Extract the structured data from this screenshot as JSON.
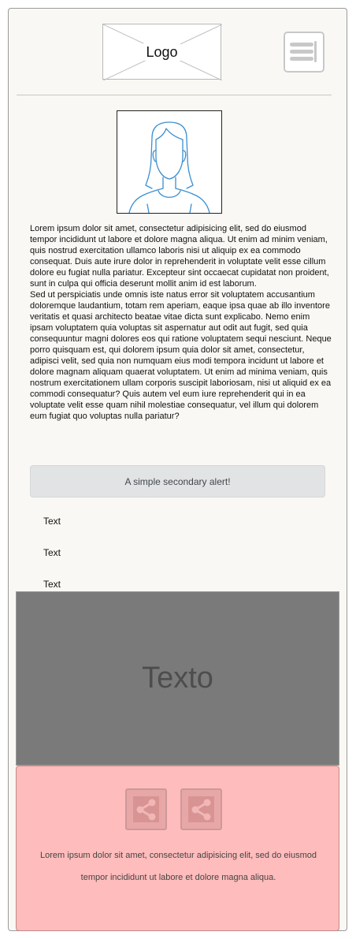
{
  "header": {
    "logo_label": "Logo",
    "menu_icon": "hamburger-menu-icon"
  },
  "profile": {
    "avatar_icon": "female-avatar-icon"
  },
  "content": {
    "paragraph_1": "Lorem ipsum dolor sit amet, consectetur adipisicing elit, sed do eiusmod tempor incididunt ut labore et dolore magna aliqua. Ut enim ad minim veniam, quis nostrud exercitation ullamco laboris nisi ut aliquip ex ea commodo consequat. Duis aute irure dolor in reprehenderit in voluptate velit esse cillum dolore eu fugiat nulla pariatur. Excepteur sint occaecat cupidatat non proident, sunt in culpa qui officia deserunt mollit anim id est laborum.",
    "paragraph_2": "Sed ut perspiciatis unde omnis iste natus error sit voluptatem accusantium doloremque laudantium, totam rem aperiam, eaque ipsa quae ab illo inventore veritatis et quasi architecto beatae vitae dicta sunt explicabo. Nemo enim ipsam voluptatem quia voluptas sit aspernatur aut odit aut fugit, sed quia consequuntur magni dolores eos qui ratione voluptatem sequi nesciunt. Neque porro quisquam est, qui dolorem ipsum quia dolor sit amet, consectetur, adipisci velit, sed quia non numquam eius modi tempora incidunt ut labore et dolore magnam aliquam quaerat voluptatem. Ut enim ad minima veniam, quis nostrum exercitationem ullam corporis suscipit laboriosam, nisi ut aliquid ex ea commodi consequatur? Quis autem vel eum iure reprehenderit qui in ea voluptate velit esse quam nihil molestiae consequatur, vel illum qui dolorem eum fugiat quo voluptas nulla pariatur?"
  },
  "alert": {
    "text": "A simple secondary alert!",
    "background": "#e2e3e5"
  },
  "text_items": [
    "Text",
    "Text",
    "Text"
  ],
  "hero": {
    "text": "Texto",
    "background": "#7a7a7a"
  },
  "footer": {
    "background": "#ffbcbc",
    "share_icons": [
      "share-icon",
      "share-icon"
    ],
    "text": "Lorem ipsum dolor sit amet, consectetur adipisicing elit, sed do eiusmod tempor incididunt ut labore et dolore magna aliqua."
  }
}
